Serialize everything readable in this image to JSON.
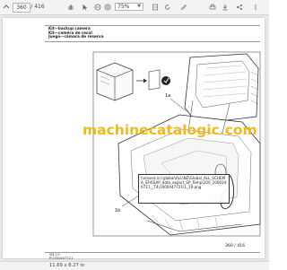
{
  "toolbar": {
    "current_page": "360",
    "page_total": "/ 416",
    "zoom": "75%"
  },
  "page": {
    "heading_en": "Kit—backup camera",
    "heading_fr": "Kit—caméra de recul",
    "heading_es": "Juego—cámara de reserva",
    "callout_a": "1a",
    "callout_b": "1b",
    "watermark": "machinecatalogic.com",
    "file_path": "\\\\vmsed.ncl.global\\ALL\\NZ\\Global_ALL_SCHEMA_SF4\\SAP_data_export_SP_Temp\\200_1000340717__T4\\1000447721\\1_19.png",
    "page_number": "360 / 416",
    "doc_code_1": "SM-1O",
    "doc_code_2": "P/1000447721"
  },
  "status": {
    "page_size": "11.69 x 8.27 in"
  }
}
